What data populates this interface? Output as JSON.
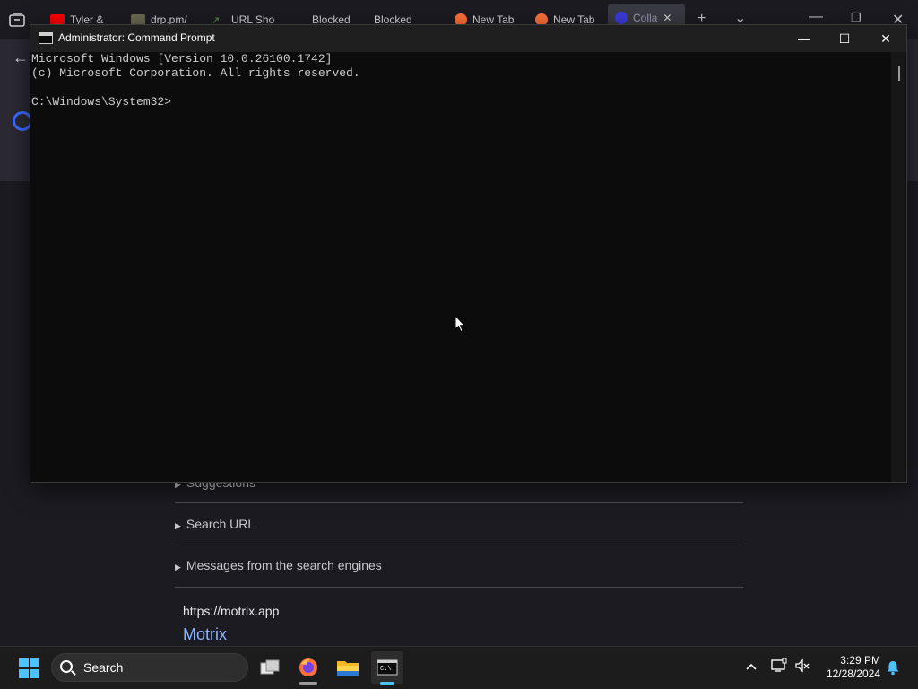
{
  "browser": {
    "tabs": [
      {
        "label": "Tyler & ",
        "favicon_color": "#ff0000"
      },
      {
        "label": "drp.pm/",
        "favicon_color": "#6a6a50"
      },
      {
        "label": "URL Sho",
        "favicon_color": "#5a9e3a"
      },
      {
        "label": "Blocked",
        "favicon_color": ""
      },
      {
        "label": "Blocked",
        "favicon_color": ""
      },
      {
        "label": "New Tab",
        "favicon_color": "#ff7139"
      },
      {
        "label": "New Tab",
        "favicon_color": "#ff7139"
      },
      {
        "label": "Colla",
        "favicon_color": "#3c3cdc"
      }
    ],
    "new_tab_glyph": "+",
    "tab_list_glyph": "⌄",
    "close_tab_glyph": "✕",
    "back_glyph": "←",
    "page": {
      "sections": [
        {
          "label": "Suggestions"
        },
        {
          "label": "Search URL"
        },
        {
          "label": "Messages from the search engines"
        }
      ],
      "result": {
        "url": "https://motrix.app",
        "title": "Motrix"
      }
    }
  },
  "cmd": {
    "title": "Administrator: Command Prompt",
    "lines": [
      "Microsoft Windows [Version 10.0.26100.1742]",
      "(c) Microsoft Corporation. All rights reserved.",
      "",
      "C:\\Windows\\System32>"
    ],
    "controls": {
      "minimize": "—",
      "maximize": "☐",
      "close": "✕"
    }
  },
  "taskbar": {
    "search_placeholder": "Search",
    "apps": [
      {
        "name": "task-view",
        "active": false
      },
      {
        "name": "firefox",
        "active": false,
        "running": true
      },
      {
        "name": "file-explorer",
        "active": false
      },
      {
        "name": "command-prompt",
        "active": true
      }
    ],
    "tray": {
      "chevron": "^"
    },
    "clock": {
      "time": "3:29 PM",
      "date": "12/28/2024"
    }
  },
  "colors": {
    "accent": "#4cc2ff",
    "link": "#8ab4ff",
    "terminal_text": "#cccccc"
  }
}
